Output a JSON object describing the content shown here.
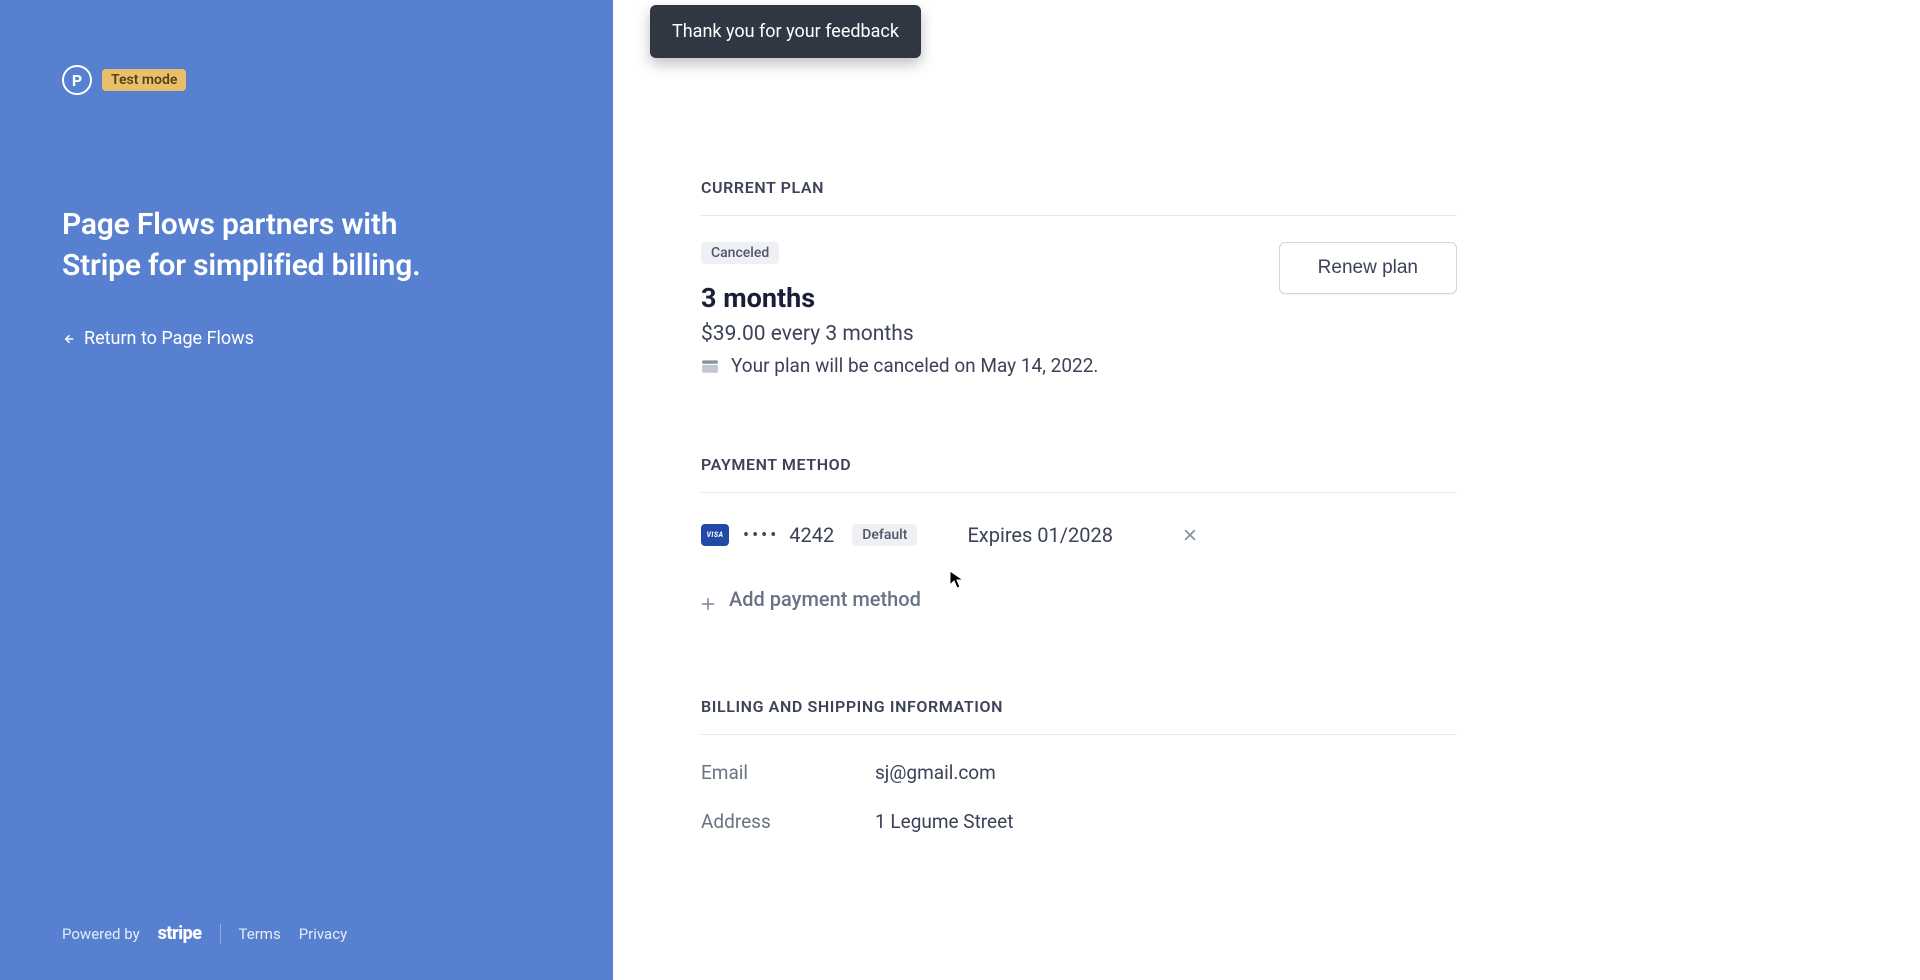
{
  "toast": {
    "message": "Thank you for your feedback"
  },
  "left_panel": {
    "brand_letter": "P",
    "mode_badge": "Test mode",
    "headline_line1": "Page Flows partners with",
    "headline_line2": "Stripe for simplified billing.",
    "return_label": "Return to Page Flows",
    "footer": {
      "powered_by": "Powered by",
      "stripe": "stripe",
      "terms": "Terms",
      "privacy": "Privacy"
    }
  },
  "current_plan": {
    "section_title": "CURRENT PLAN",
    "status": "Canceled",
    "plan_name": "3 months",
    "price_line": "$39.00 every 3 months",
    "cancel_notice": "Your plan will be canceled on May 14, 2022.",
    "renew_button": "Renew plan"
  },
  "payment_method": {
    "section_title": "PAYMENT METHOD",
    "card": {
      "brand": "VISA",
      "masked": "••••",
      "last4": "4242",
      "default_badge": "Default",
      "expires": "Expires 01/2028"
    },
    "add_label": "Add payment method"
  },
  "billing": {
    "section_title": "BILLING AND SHIPPING INFORMATION",
    "rows": [
      {
        "label": "Email",
        "value": "sj@gmail.com"
      },
      {
        "label": "Address",
        "value": "1 Legume Street"
      }
    ]
  }
}
